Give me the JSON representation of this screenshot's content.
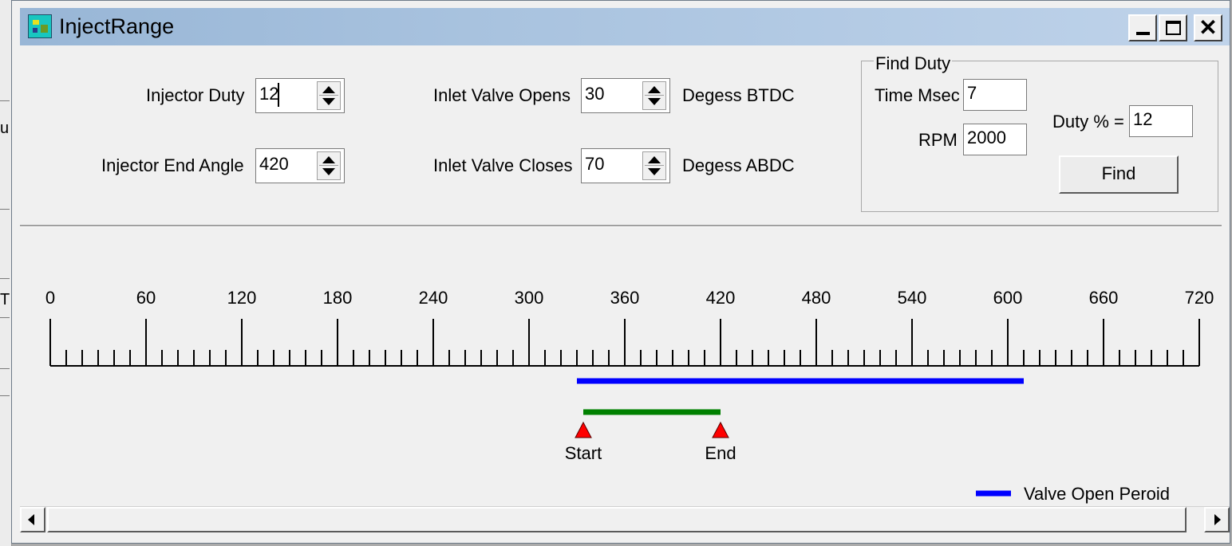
{
  "window": {
    "title": "InjectRange"
  },
  "titlebar": {
    "close_glyph": "✕"
  },
  "controls": {
    "injector_duty": {
      "label": "Injector Duty",
      "value": "12"
    },
    "injector_end_angle": {
      "label": "Injector End Angle",
      "value": "420"
    },
    "inlet_valve_opens": {
      "label": "Inlet Valve Opens",
      "value": "30",
      "unit": "Degess BTDC"
    },
    "inlet_valve_closes": {
      "label": "Inlet Valve Closes",
      "value": "70",
      "unit": "Degess ABDC"
    }
  },
  "find_duty": {
    "title": "Find Duty",
    "time_label": "Time Msec",
    "time_value": "7",
    "rpm_label": "RPM",
    "rpm_value": "2000",
    "duty_label": "Duty % =",
    "duty_value": "12",
    "find_button": "Find"
  },
  "chart_data": {
    "type": "timeline",
    "axis_ticks": [
      "0",
      "60",
      "120",
      "180",
      "240",
      "300",
      "360",
      "420",
      "480",
      "540",
      "600",
      "660",
      "720"
    ],
    "xlim": [
      0,
      720
    ],
    "minor_step": 10,
    "valve_open": {
      "start": 330,
      "end": 610,
      "color": "#0000ff"
    },
    "injection": {
      "start": 334,
      "end": 420,
      "color": "#008000"
    },
    "markers": [
      {
        "label": "Start",
        "value": 334,
        "color": "#ff0000"
      },
      {
        "label": "End",
        "value": 420,
        "color": "#ff0000"
      }
    ],
    "legend": {
      "label": "Valve Open Peroid",
      "color": "#0000ff"
    }
  },
  "left_edge": {
    "glyph1": "u",
    "glyph2": "T"
  }
}
